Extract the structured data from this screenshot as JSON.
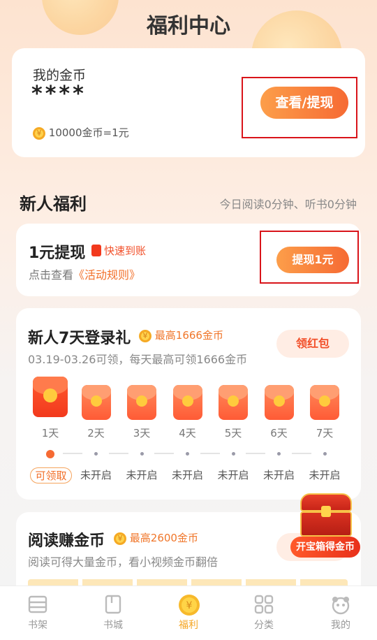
{
  "header": {
    "title": "福利中心"
  },
  "coins_card": {
    "label": "我的金币",
    "amount": "****",
    "rate": "10000金币=1元",
    "view_button": "查看/提现"
  },
  "newbie": {
    "section_title": "新人福利",
    "today_stats": "今日阅读0分钟、听书0分钟"
  },
  "withdraw_card": {
    "title": "1元提现",
    "badge": "快速到账",
    "hint_prefix": "点击查看",
    "rules_link": "《活动规则》",
    "button": "提现1元"
  },
  "login_card": {
    "title": "新人7天登录礼",
    "max_badge": "最高1666金币",
    "desc": "03.19-03.26可领，每天最高可领1666金币",
    "button": "领红包",
    "days": [
      {
        "label": "1天",
        "status": "可领取"
      },
      {
        "label": "2天",
        "status": "未开启"
      },
      {
        "label": "3天",
        "status": "未开启"
      },
      {
        "label": "4天",
        "status": "未开启"
      },
      {
        "label": "5天",
        "status": "未开启"
      },
      {
        "label": "6天",
        "status": "未开启"
      },
      {
        "label": "7天",
        "status": "未开启"
      }
    ]
  },
  "read_card": {
    "title": "阅读赚金币",
    "max_badge": "最高2600金币",
    "desc": "阅读可得大量金币，看小视频金币翻倍"
  },
  "treasure": {
    "label": "开宝箱得金币"
  },
  "bottom_nav": [
    {
      "label": "书架",
      "icon": "bookshelf-icon"
    },
    {
      "label": "书城",
      "icon": "bookstore-icon"
    },
    {
      "label": "福利",
      "icon": "yuan-coin-icon"
    },
    {
      "label": "分类",
      "icon": "category-grid-icon"
    },
    {
      "label": "我的",
      "icon": "panda-profile-icon"
    }
  ],
  "colors": {
    "accent": "#f66a33",
    "active_nav": "#f5a623",
    "highlight_box": "#d9141a"
  }
}
